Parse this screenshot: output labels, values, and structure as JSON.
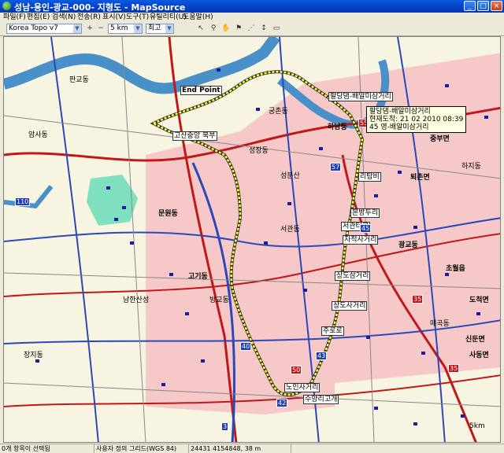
{
  "window": {
    "title": "성남-용인-광교-000- 지형도 - MapSource",
    "min": "_",
    "max": "□",
    "close": "×"
  },
  "menu": [
    "파일(F)",
    "편집(E)",
    "검색(N)",
    "전송(R)",
    "표시(V)",
    "도구(T)",
    "유틸리티(U)",
    "도움말(H)"
  ],
  "toolbar": {
    "map_product": "Korea Topo v7",
    "scale": "5 km",
    "detail": "최고",
    "zoom_in_icon": "+",
    "zoom_out_icon": "−"
  },
  "map": {
    "tooltip": {
      "line1": "팔당댐-배알미삼거리",
      "line2": "현재도착: 21 02 2010 08:39",
      "line3": "45 영-배알미삼거리"
    },
    "route_labels": [
      "팔당댐-배알미삼거리",
      "고산중앙 북부",
      "리탐비",
      "본방두리",
      "서관터교",
      "자적사거리",
      "상도삼거리",
      "상도사거리",
      "주로로",
      "노인사거리",
      "수양리고개"
    ],
    "place_labels": [
      "판교동",
      "하남동",
      "고기동",
      "문원동",
      "성분산",
      "퇴촌면",
      "중부면",
      "하지동",
      "궁촌동",
      "성장동",
      "방교동",
      "장지동",
      "서관동",
      "광교동",
      "매곡동",
      "초월읍",
      "도척면",
      "신둔면",
      "사동면",
      "암사동",
      "남한산성",
      "End Point"
    ],
    "road_numbers": [
      "110",
      "45",
      "57",
      "55",
      "35",
      "35",
      "50",
      "40",
      "43",
      "42",
      "3"
    ],
    "scale_note": "5km"
  },
  "status": {
    "selection": "0개 항목이 선택됨",
    "grid": "사용자 정의 그리드(WGS 84)",
    "coords": "24431 4154848, 38 m",
    "extra": ""
  },
  "colors": {
    "urban_pink": "#f6c8c8",
    "land": "#f7f4e2",
    "water": "#4a90c8",
    "forest": "#7fe0c0",
    "route_yellow": "#ffff33",
    "highway_red": "#c01818",
    "road_blue": "#2a48b8"
  }
}
